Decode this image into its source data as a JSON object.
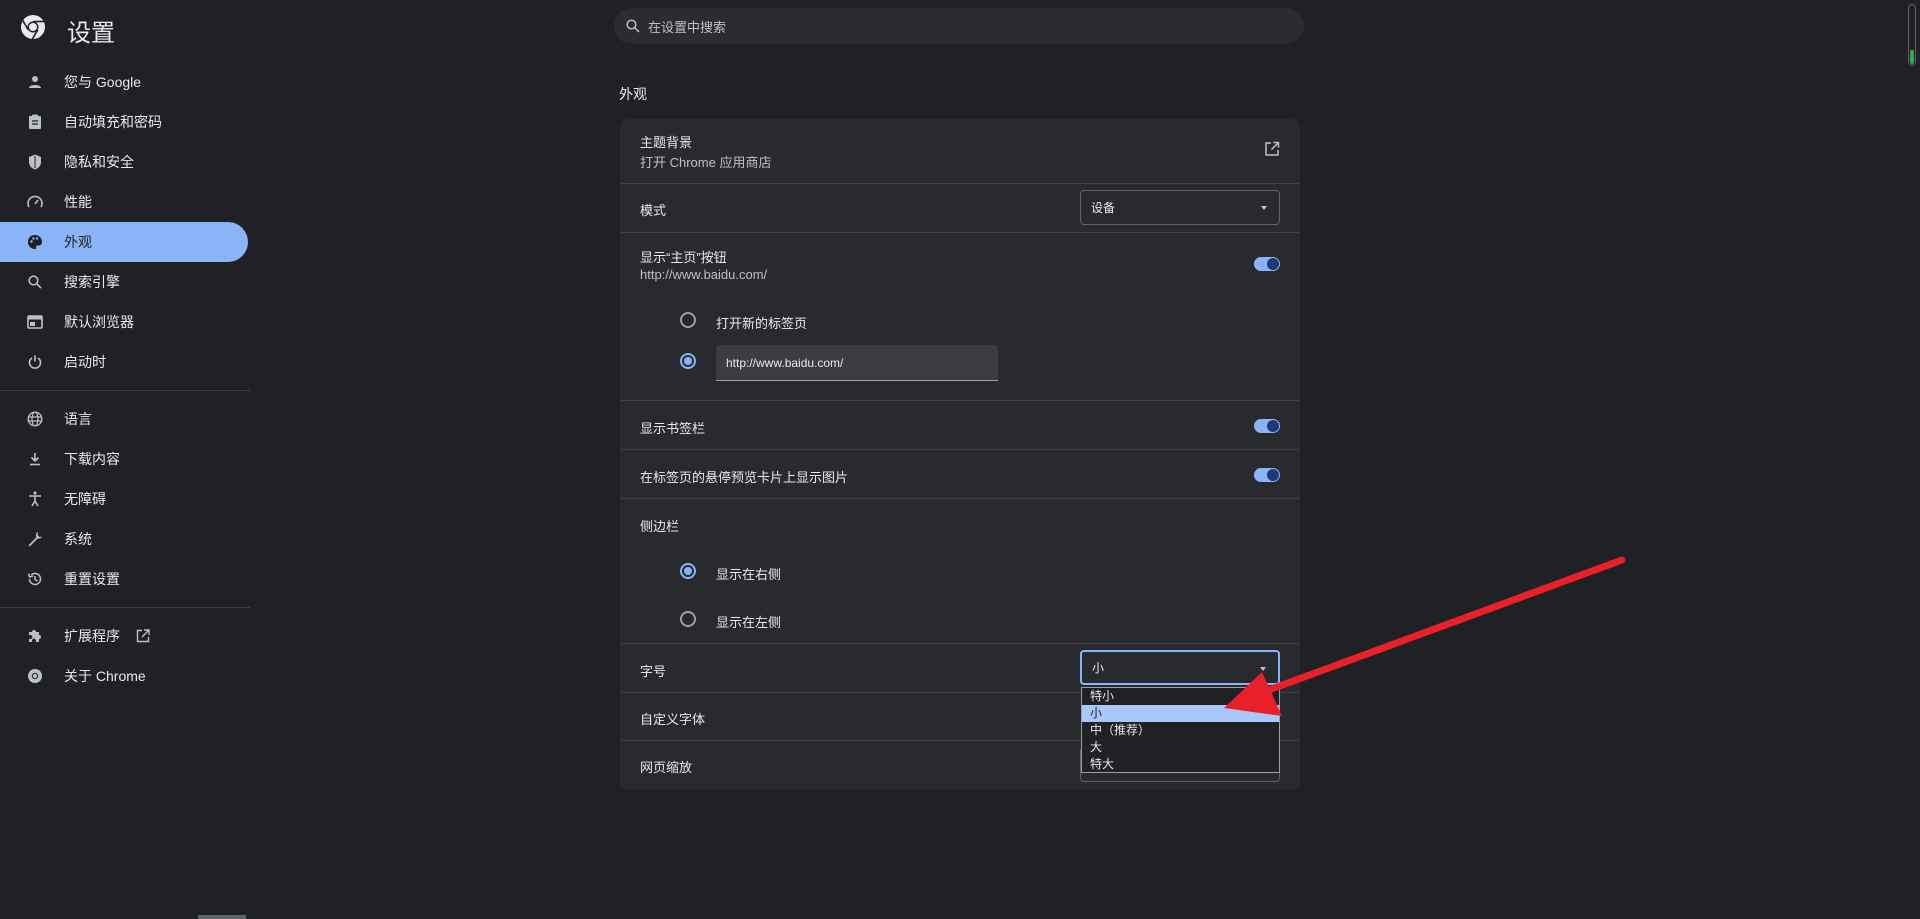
{
  "app": {
    "title": "设置"
  },
  "search": {
    "placeholder": "在设置中搜索"
  },
  "sidebar": {
    "items": [
      {
        "label": "您与 Google",
        "icon": "person-icon"
      },
      {
        "label": "自动填充和密码",
        "icon": "clipboard-icon"
      },
      {
        "label": "隐私和安全",
        "icon": "shield-icon"
      },
      {
        "label": "性能",
        "icon": "speedometer-icon"
      },
      {
        "label": "外观",
        "icon": "palette-icon",
        "active": true
      },
      {
        "label": "搜索引擎",
        "icon": "search-icon"
      },
      {
        "label": "默认浏览器",
        "icon": "browser-icon"
      },
      {
        "label": "启动时",
        "icon": "power-icon"
      },
      {
        "label": "语言",
        "icon": "globe-icon"
      },
      {
        "label": "下载内容",
        "icon": "download-icon"
      },
      {
        "label": "无障碍",
        "icon": "accessibility-icon"
      },
      {
        "label": "系统",
        "icon": "wrench-icon"
      },
      {
        "label": "重置设置",
        "icon": "history-icon"
      },
      {
        "label": "扩展程序",
        "icon": "puzzle-icon"
      },
      {
        "label": "关于 Chrome",
        "icon": "chrome-icon"
      }
    ]
  },
  "main": {
    "section_title": "外观",
    "theme": {
      "label": "主题背景",
      "sub": "打开 Chrome 应用商店"
    },
    "mode": {
      "label": "模式",
      "value": "设备"
    },
    "home_button": {
      "label": "显示“主页”按钮",
      "sub": "http://www.baidu.com/",
      "enabled": true
    },
    "home_options": {
      "new_tab_label": "打开新的标签页",
      "custom_url_value": "http://www.baidu.com/",
      "selected": "custom"
    },
    "bookmarks_bar": {
      "label": "显示书签栏",
      "enabled": true
    },
    "tab_hover": {
      "label": "在标签页的悬停预览卡片上显示图片",
      "enabled": true
    },
    "side_panel": {
      "label": "侧边栏",
      "right_label": "显示在右侧",
      "left_label": "显示在左侧",
      "selected": "right"
    },
    "font_size": {
      "label": "字号",
      "value": "小",
      "options": [
        "特小",
        "小",
        "中（推荐）",
        "大",
        "特大"
      ],
      "selected_index": 1
    },
    "custom_fonts": {
      "label": "自定义字体"
    },
    "page_zoom": {
      "label": "网页缩放"
    }
  },
  "colors": {
    "accent": "#8ab4f8",
    "background": "#202124",
    "card": "#292a2d",
    "arrow": "#e8202a"
  }
}
